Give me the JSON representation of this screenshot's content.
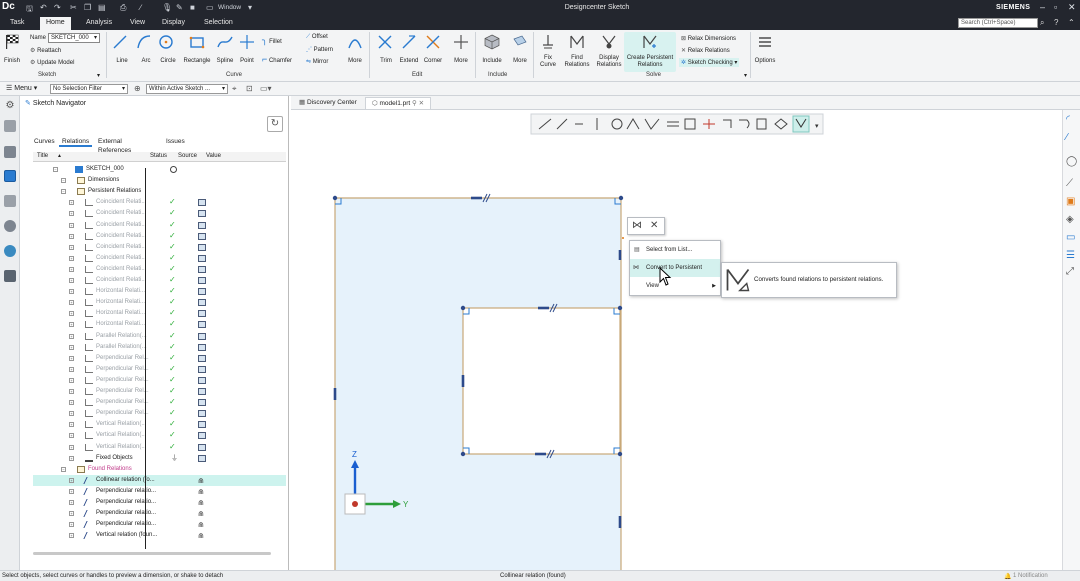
{
  "window": {
    "app_logo": "Dc",
    "title": "Designcenter Sketch",
    "brand": "SIEMENS",
    "quick_access_window": "Window"
  },
  "menu_tabs": [
    {
      "label": "Task"
    },
    {
      "label": "Home",
      "active": true
    },
    {
      "label": "Analysis"
    },
    {
      "label": "View"
    },
    {
      "label": "Display"
    },
    {
      "label": "Selection"
    }
  ],
  "search": {
    "placeholder": "Search (Ctrl+Space)"
  },
  "ribbon": {
    "sketch_group": {
      "label": "Sketch",
      "finish": "Finish",
      "name_label": "Name",
      "name_value": "SKETCH_000",
      "reattach": "Reattach",
      "update_model": "Update Model"
    },
    "curve_group": {
      "label": "Curve",
      "line": "Line",
      "arc": "Arc",
      "circle": "Circle",
      "rectangle": "Rectangle",
      "spline": "Spline",
      "point": "Point",
      "fillet": "Fillet",
      "chamfer": "Chamfer",
      "offset": "Offset",
      "pattern": "Pattern",
      "mirror": "Mirror",
      "more": "More"
    },
    "edit_group": {
      "label": "Edit",
      "trim": "Trim",
      "extend": "Extend",
      "corner": "Corner",
      "more": "More"
    },
    "include_group": {
      "label": "Include",
      "include": "Include",
      "more": "More"
    },
    "solve_group": {
      "label": "Solve",
      "fix_curve": "Fix\nCurve",
      "find_relations": "Find\nRelations",
      "display_relations": "Display\nRelations",
      "create_persistent": "Create Persistent\nRelations",
      "relax_dimensions": "Relax Dimensions",
      "relax_relations": "Relax Relations",
      "sketch_checking": "Sketch Checking"
    },
    "options": "Options"
  },
  "toolbar2": {
    "menu": "Menu",
    "selection_filter": "No Selection Filter",
    "scope": "Within Active Sketch ..."
  },
  "navigator": {
    "title": "Sketch Navigator",
    "tabs": [
      "Curves",
      "Relations",
      "External References",
      "Issues"
    ],
    "columns": {
      "title": "Title",
      "status": "Status",
      "source": "Source",
      "value": "Value"
    },
    "rows": [
      {
        "label": "SKETCH_000",
        "indent": 0,
        "type": "root"
      },
      {
        "label": "Dimensions",
        "indent": 1,
        "type": "folder"
      },
      {
        "label": "Persistent Relations",
        "indent": 1,
        "type": "folder"
      },
      {
        "label": "Coincident Relati...",
        "indent": 2,
        "type": "rel",
        "grey": true
      },
      {
        "label": "Coincident Relati...",
        "indent": 2,
        "type": "rel",
        "grey": true
      },
      {
        "label": "Coincident Relati...",
        "indent": 2,
        "type": "rel",
        "grey": true
      },
      {
        "label": "Coincident Relati...",
        "indent": 2,
        "type": "rel",
        "grey": true
      },
      {
        "label": "Coincident Relati...",
        "indent": 2,
        "type": "rel",
        "grey": true
      },
      {
        "label": "Coincident Relati...",
        "indent": 2,
        "type": "rel",
        "grey": true
      },
      {
        "label": "Coincident Relati...",
        "indent": 2,
        "type": "rel",
        "grey": true
      },
      {
        "label": "Coincident Relati...",
        "indent": 2,
        "type": "rel",
        "grey": true
      },
      {
        "label": "Horizontal Relati...",
        "indent": 2,
        "type": "rel",
        "grey": true
      },
      {
        "label": "Horizontal Relati...",
        "indent": 2,
        "type": "rel",
        "grey": true
      },
      {
        "label": "Horizontal Relati...",
        "indent": 2,
        "type": "rel",
        "grey": true
      },
      {
        "label": "Horizontal Relati...",
        "indent": 2,
        "type": "rel",
        "grey": true
      },
      {
        "label": "Parallel Relation(...",
        "indent": 2,
        "type": "rel",
        "grey": true
      },
      {
        "label": "Parallel Relation(...",
        "indent": 2,
        "type": "rel",
        "grey": true
      },
      {
        "label": "Perpendicular Rel...",
        "indent": 2,
        "type": "rel",
        "grey": true
      },
      {
        "label": "Perpendicular Rel...",
        "indent": 2,
        "type": "rel",
        "grey": true
      },
      {
        "label": "Perpendicular Rel...",
        "indent": 2,
        "type": "rel",
        "grey": true
      },
      {
        "label": "Perpendicular Rel...",
        "indent": 2,
        "type": "rel",
        "grey": true
      },
      {
        "label": "Perpendicular Rel...",
        "indent": 2,
        "type": "rel",
        "grey": true
      },
      {
        "label": "Perpendicular Rel...",
        "indent": 2,
        "type": "rel",
        "grey": true
      },
      {
        "label": "Vertical Relation(...",
        "indent": 2,
        "type": "rel",
        "grey": true
      },
      {
        "label": "Vertical Relation(...",
        "indent": 2,
        "type": "rel",
        "grey": true
      },
      {
        "label": "Vertical Relation(...",
        "indent": 2,
        "type": "rel",
        "grey": true
      },
      {
        "label": "Fixed Objects",
        "indent": 2,
        "type": "fixed"
      },
      {
        "label": "Found Relations",
        "indent": 1,
        "type": "found-folder"
      },
      {
        "label": "Collinear relation (fo...",
        "indent": 2,
        "type": "found",
        "selected": true
      },
      {
        "label": "Perpendicular relatio...",
        "indent": 2,
        "type": "found"
      },
      {
        "label": "Perpendicular relatio...",
        "indent": 2,
        "type": "found"
      },
      {
        "label": "Perpendicular relatio...",
        "indent": 2,
        "type": "found"
      },
      {
        "label": "Perpendicular relatio...",
        "indent": 2,
        "type": "found"
      },
      {
        "label": "Vertical relation (foun...",
        "indent": 2,
        "type": "found"
      }
    ]
  },
  "doc_tabs": [
    {
      "label": "Discovery Center"
    },
    {
      "label": "model1.prt",
      "active": true
    }
  ],
  "axes": {
    "z": "Z",
    "y": "Y"
  },
  "context_menu": {
    "items": [
      "Select from List...",
      "Convert to Persistent",
      "View"
    ]
  },
  "tooltip": {
    "text": "Converts found relations to persistent relations."
  },
  "status": {
    "left": "Select objects, select curves or handles to preview a dimension, or shake to detach",
    "center": "Collinear relation (found)",
    "right": "1 Notification"
  },
  "colors": {
    "accent": "#2a7bd0",
    "titlebar": "#23262e",
    "sketch_fill": "#e6f2fb",
    "sketch_line": "#c8a878",
    "relation_glyph": "#2d4a8a",
    "check": "#2fae3a",
    "found_folder": "#c03a8a",
    "highlight": "#cdf3ee"
  }
}
